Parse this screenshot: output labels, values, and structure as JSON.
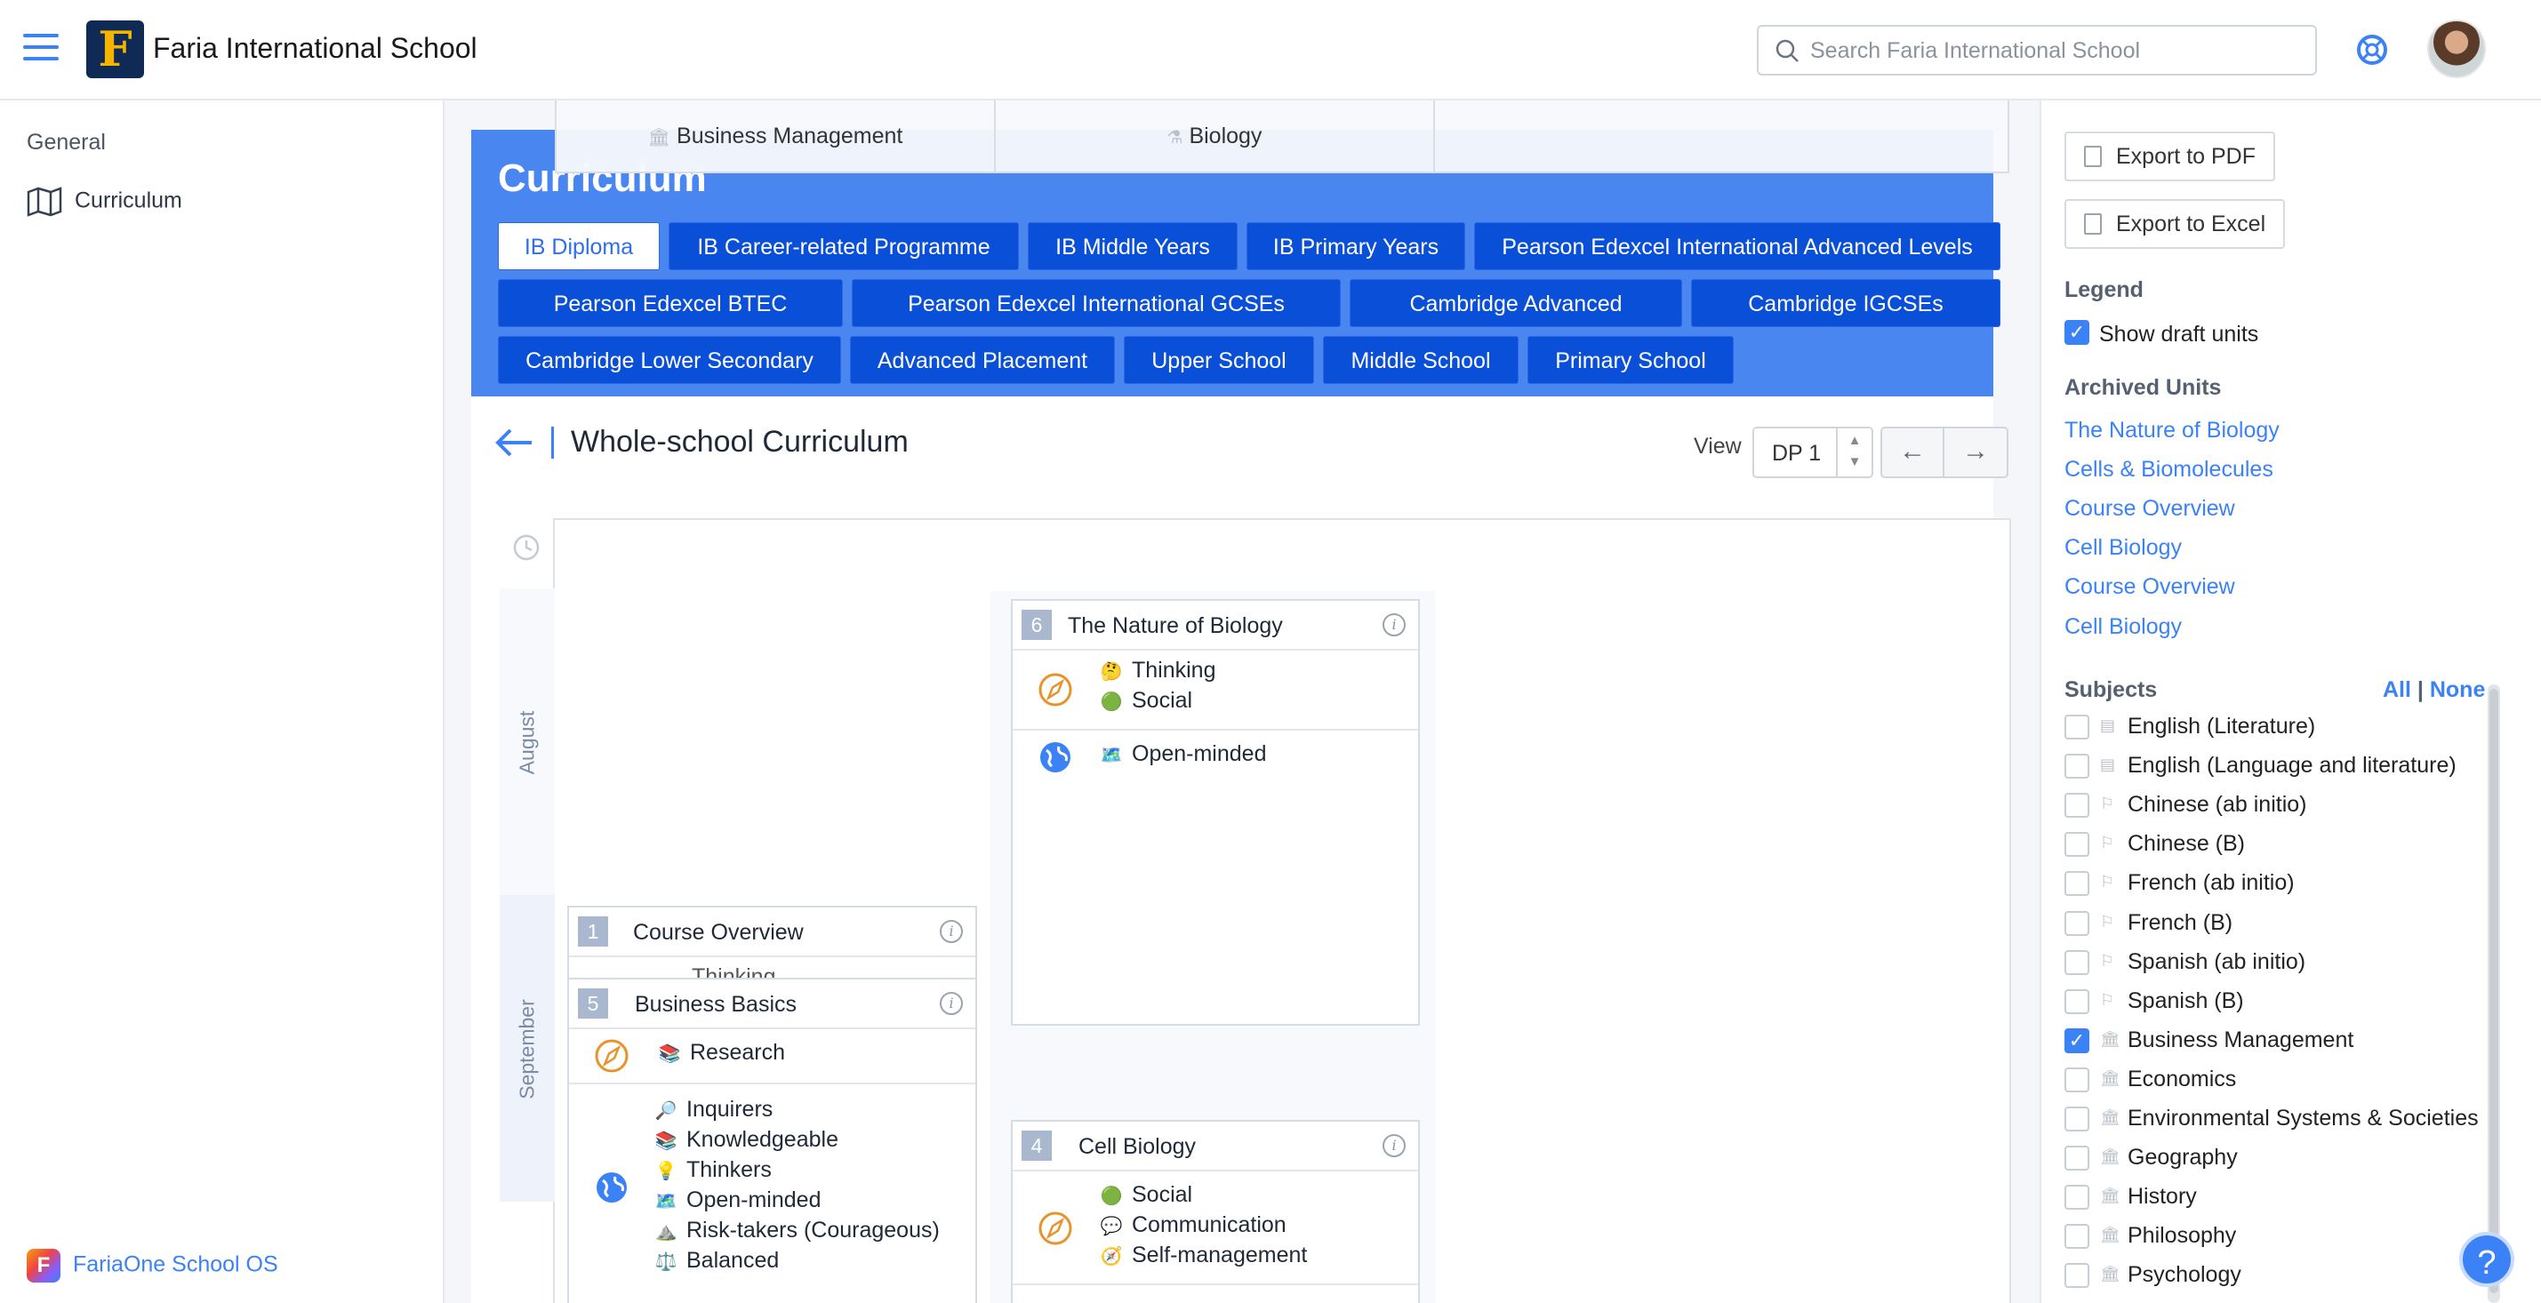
{
  "header": {
    "school_name": "Faria International School",
    "logo_letter": "F",
    "search_placeholder": "Search Faria International School"
  },
  "left_nav": {
    "section_label": "General",
    "items": [
      {
        "label": "Curriculum",
        "icon": "map-icon"
      }
    ],
    "footer": "FariaOne School OS"
  },
  "sticky_columns": [
    "Business Management",
    "Biology",
    ""
  ],
  "main": {
    "title": "Curriculum",
    "programmes": [
      "IB Diploma",
      "IB Career-related Programme",
      "IB Middle Years",
      "IB Primary Years",
      "Pearson Edexcel International Advanced Levels",
      "Pearson Edexcel BTEC",
      "Pearson Edexcel International GCSEs",
      "Cambridge Advanced",
      "Cambridge IGCSEs",
      "Cambridge Lower Secondary",
      "Advanced Placement",
      "Upper School",
      "Middle School",
      "Primary School"
    ],
    "active_programme": "IB Diploma",
    "subtitle": "Whole-school Curriculum",
    "view_label": "View",
    "view_value": "DP 1",
    "months": [
      "August",
      "September"
    ]
  },
  "cards": [
    {
      "num": "6",
      "title": "The Nature of Biology",
      "skills": [
        {
          "emoji": "🤔",
          "label": "Thinking"
        },
        {
          "emoji": "🟢",
          "label": "Social"
        }
      ],
      "profile": [
        {
          "emoji": "🗺️",
          "label": "Open-minded"
        }
      ]
    },
    {
      "num": "1",
      "title": "Course Overview",
      "partial": "Thinking"
    },
    {
      "num": "5",
      "title": "Business Basics",
      "skills": [
        {
          "emoji": "📚",
          "label": "Research"
        }
      ],
      "profile": [
        {
          "emoji": "🔎",
          "label": "Inquirers"
        },
        {
          "emoji": "📚",
          "label": "Knowledgeable"
        },
        {
          "emoji": "💡",
          "label": "Thinkers"
        },
        {
          "emoji": "🗺️",
          "label": "Open-minded"
        },
        {
          "emoji": "⛰️",
          "label": "Risk-takers (Courageous)"
        },
        {
          "emoji": "⚖️",
          "label": "Balanced"
        }
      ]
    },
    {
      "num": "4",
      "title": "Cell Biology",
      "skills": [
        {
          "emoji": "🟢",
          "label": "Social"
        },
        {
          "emoji": "💬",
          "label": "Communication"
        },
        {
          "emoji": "🧭",
          "label": "Self-management"
        }
      ]
    }
  ],
  "right_panel": {
    "export_pdf": "Export to PDF",
    "export_excel": "Export to Excel",
    "legend_title": "Legend",
    "show_draft": "Show draft units",
    "show_draft_checked": true,
    "archived_title": "Archived Units",
    "archived": [
      "The Nature of Biology",
      "Cells & Biomolecules",
      "Course Overview",
      "Cell Biology",
      "Course Overview",
      "Cell Biology"
    ],
    "subjects_title": "Subjects",
    "all_label": "All",
    "sep": "|",
    "none_label": "None",
    "subjects": [
      {
        "label": "English (Literature)",
        "icon": "book-icon",
        "checked": false
      },
      {
        "label": "English (Language and literature)",
        "icon": "book-icon",
        "checked": false
      },
      {
        "label": "Chinese (ab initio)",
        "icon": "flag-icon",
        "checked": false
      },
      {
        "label": "Chinese (B)",
        "icon": "flag-icon",
        "checked": false
      },
      {
        "label": "French (ab initio)",
        "icon": "flag-icon",
        "checked": false
      },
      {
        "label": "French (B)",
        "icon": "flag-icon",
        "checked": false
      },
      {
        "label": "Spanish (ab initio)",
        "icon": "flag-icon",
        "checked": false
      },
      {
        "label": "Spanish (B)",
        "icon": "flag-icon",
        "checked": false
      },
      {
        "label": "Business Management",
        "icon": "bank-icon",
        "checked": true
      },
      {
        "label": "Economics",
        "icon": "bank-icon",
        "checked": false
      },
      {
        "label": "Environmental Systems & Societies",
        "icon": "bank-icon",
        "checked": false
      },
      {
        "label": "Geography",
        "icon": "bank-icon",
        "checked": false
      },
      {
        "label": "History",
        "icon": "bank-icon",
        "checked": false
      },
      {
        "label": "Philosophy",
        "icon": "bank-icon",
        "checked": false
      },
      {
        "label": "Psychology",
        "icon": "bank-icon",
        "checked": false
      }
    ]
  },
  "colors": {
    "accent": "#3b82f6",
    "programme_bg": "#0a4fd8",
    "panel_bg": "#4a86f0"
  }
}
